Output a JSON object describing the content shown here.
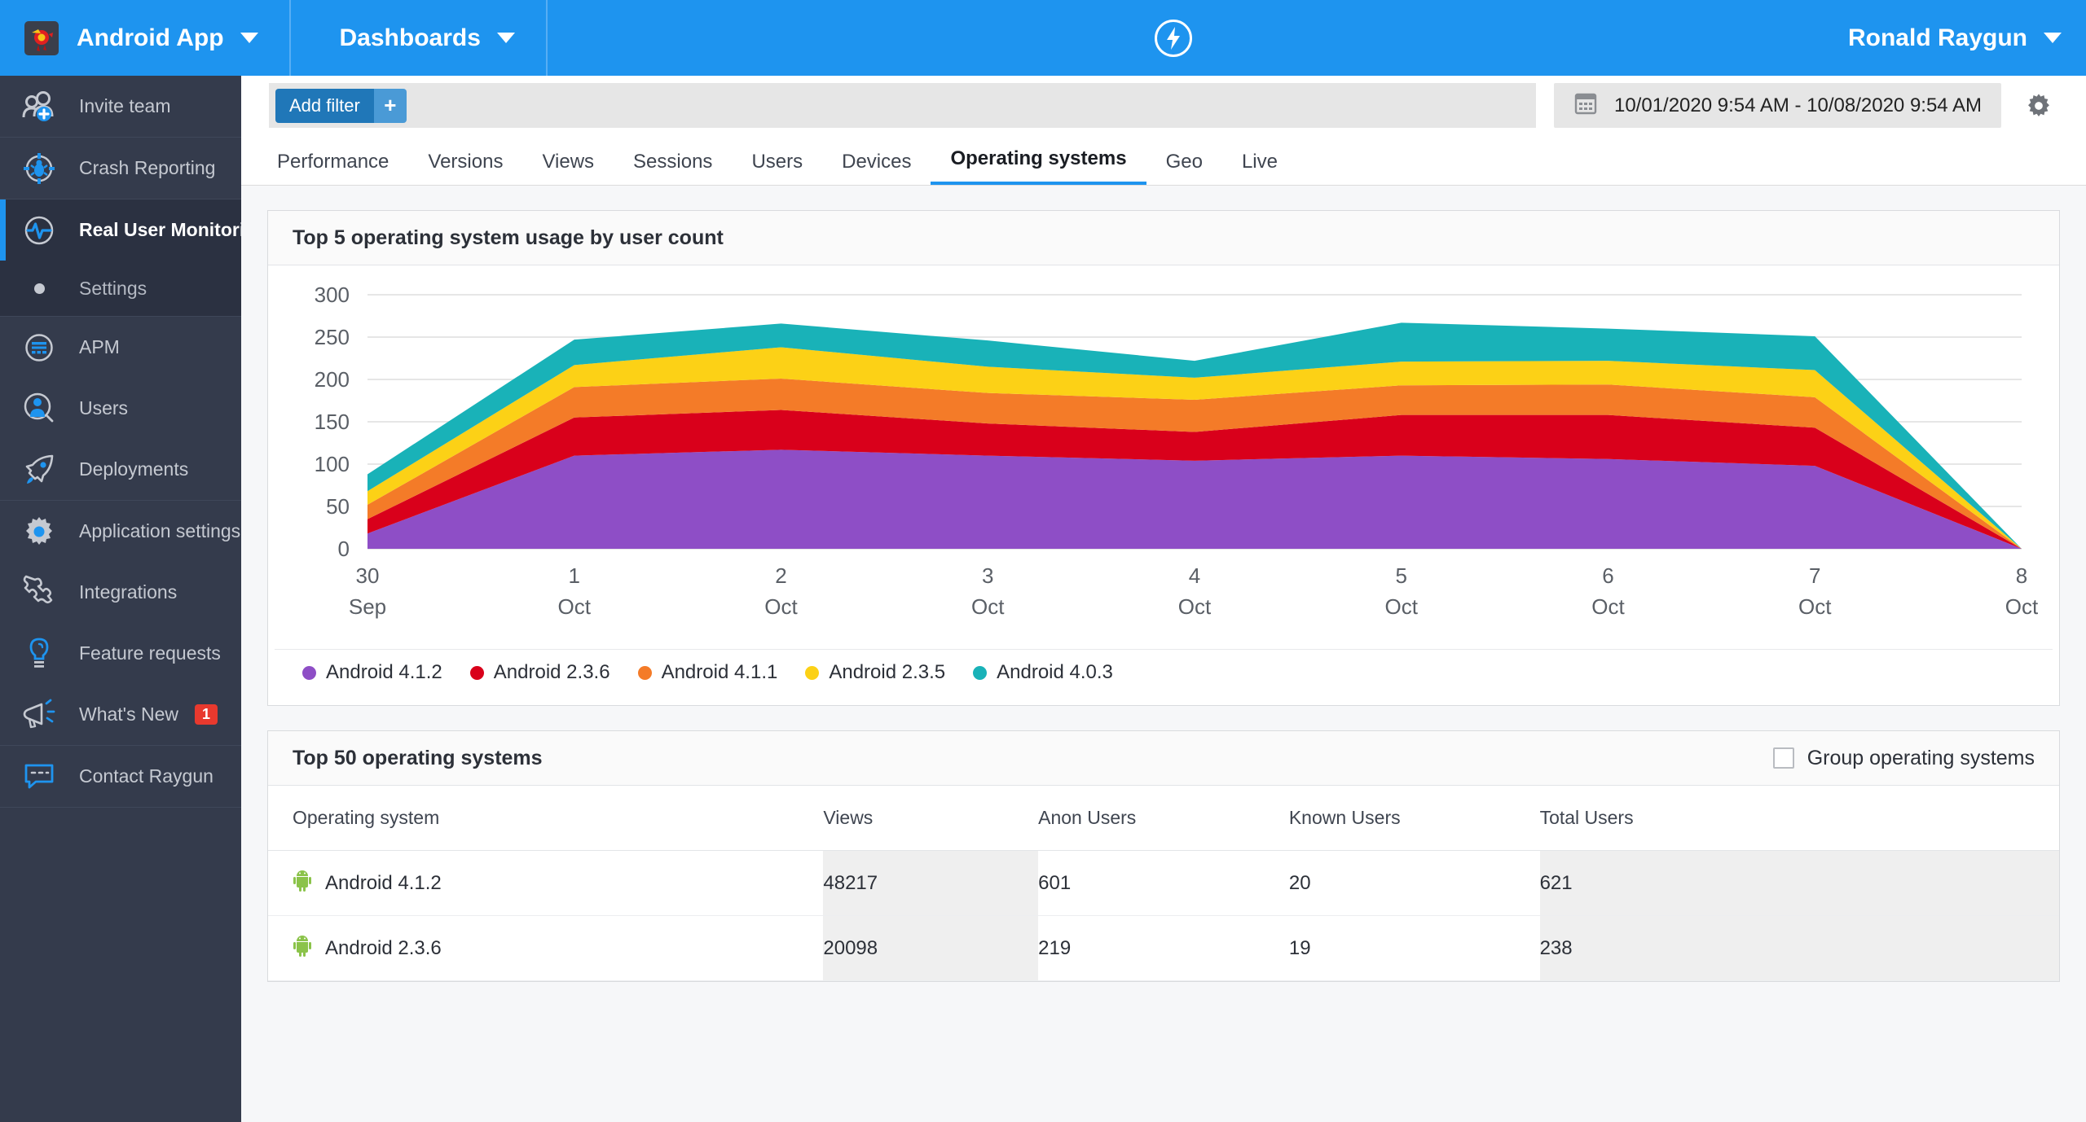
{
  "topbar": {
    "app_name": "Android App",
    "app_caret": "chevron-down-icon",
    "dashboards": "Dashboards",
    "logo": "raygun-app-logo",
    "center_icon": "bolt-icon",
    "user_name": "Ronald Raygun"
  },
  "sidebar": {
    "groups": [
      {
        "items": [
          {
            "label": "Invite team",
            "icon": "invite-team-icon",
            "active": false
          }
        ]
      },
      {
        "items": [
          {
            "label": "Crash Reporting",
            "icon": "crash-reporting-icon",
            "active": false
          }
        ]
      },
      {
        "items": [
          {
            "label": "Real User Monitoring",
            "icon": "real-user-monitoring-icon",
            "active": true
          }
        ],
        "sub": [
          {
            "label": "Settings",
            "icon": "bullet-dot-icon"
          }
        ]
      },
      {
        "items": [
          {
            "label": "APM",
            "icon": "apm-icon",
            "active": false
          },
          {
            "label": "Users",
            "icon": "users-icon",
            "active": false
          },
          {
            "label": "Deployments",
            "icon": "rocket-icon",
            "active": false
          }
        ]
      },
      {
        "items": [
          {
            "label": "Application settings",
            "icon": "gear-icon",
            "active": false
          },
          {
            "label": "Integrations",
            "icon": "puzzle-icon",
            "active": false
          },
          {
            "label": "Feature requests",
            "icon": "lightbulb-icon",
            "active": false
          },
          {
            "label": "What's New",
            "icon": "megaphone-icon",
            "active": false,
            "badge": "1"
          }
        ]
      },
      {
        "items": [
          {
            "label": "Contact Raygun",
            "icon": "chat-icon",
            "active": false
          }
        ]
      }
    ]
  },
  "toolbar": {
    "add_filter_label": "Add filter",
    "add_filter_plus": "+",
    "date_range": "10/01/2020 9:54 AM - 10/08/2020 9:54 AM",
    "calendar_icon": "calendar-icon",
    "settings_icon": "gear-icon"
  },
  "tabs": [
    {
      "label": "Performance",
      "active": false
    },
    {
      "label": "Versions",
      "active": false
    },
    {
      "label": "Views",
      "active": false
    },
    {
      "label": "Sessions",
      "active": false
    },
    {
      "label": "Users",
      "active": false
    },
    {
      "label": "Devices",
      "active": false
    },
    {
      "label": "Operating systems",
      "active": true
    },
    {
      "label": "Geo",
      "active": false
    },
    {
      "label": "Live",
      "active": false
    }
  ],
  "chart_card": {
    "title": "Top 5 operating system usage by user count"
  },
  "chart_data": {
    "type": "area",
    "title": "Top 5 operating system usage by user count",
    "stacked": true,
    "xlabel": "",
    "ylabel": "",
    "ylim": [
      0,
      300
    ],
    "yticks": [
      0,
      50,
      100,
      150,
      200,
      250,
      300
    ],
    "grid": true,
    "legend_position": "bottom",
    "categories": [
      "30 Sep",
      "1 Oct",
      "2 Oct",
      "3 Oct",
      "4 Oct",
      "5 Oct",
      "6 Oct",
      "7 Oct",
      "8 Oct"
    ],
    "x_tick_days": [
      "30",
      "1",
      "2",
      "3",
      "4",
      "5",
      "6",
      "7",
      "8"
    ],
    "x_tick_months": [
      "Sep",
      "Oct",
      "Oct",
      "Oct",
      "Oct",
      "Oct",
      "Oct",
      "Oct",
      "Oct"
    ],
    "series": [
      {
        "name": "Android 4.1.2",
        "color": "#8e4ec6",
        "values": [
          18,
          110,
          117,
          110,
          104,
          110,
          106,
          98,
          0
        ]
      },
      {
        "name": "Android 2.3.6",
        "color": "#d9001b",
        "values": [
          17,
          45,
          47,
          38,
          34,
          48,
          52,
          45,
          0
        ]
      },
      {
        "name": "Android 4.1.1",
        "color": "#f47b28",
        "values": [
          17,
          36,
          37,
          36,
          38,
          35,
          36,
          36,
          0
        ]
      },
      {
        "name": "Android 2.3.5",
        "color": "#fcd116",
        "values": [
          16,
          26,
          37,
          31,
          26,
          28,
          28,
          32,
          0
        ]
      },
      {
        "name": "Android 4.0.3",
        "color": "#19b2b8",
        "values": [
          20,
          30,
          28,
          31,
          20,
          46,
          38,
          40,
          0
        ]
      }
    ],
    "legend": [
      "Android 4.1.2",
      "Android 2.3.6",
      "Android 4.1.1",
      "Android 2.3.5",
      "Android 4.0.3"
    ],
    "colors": [
      "#8e4ec6",
      "#d9001b",
      "#f47b28",
      "#fcd116",
      "#19b2b8"
    ]
  },
  "table_card": {
    "title": "Top 50 operating systems",
    "group_label": "Group operating systems",
    "group_checked": false,
    "columns": [
      "Operating system",
      "Views",
      "Anon Users",
      "Known Users",
      "Total Users"
    ],
    "rows": [
      {
        "os": "Android 4.1.2",
        "views": "48217",
        "anon": "601",
        "known": "20",
        "total": "621",
        "icon": "android-icon"
      },
      {
        "os": "Android 2.3.6",
        "views": "20098",
        "anon": "219",
        "known": "19",
        "total": "238",
        "icon": "android-icon"
      }
    ]
  }
}
